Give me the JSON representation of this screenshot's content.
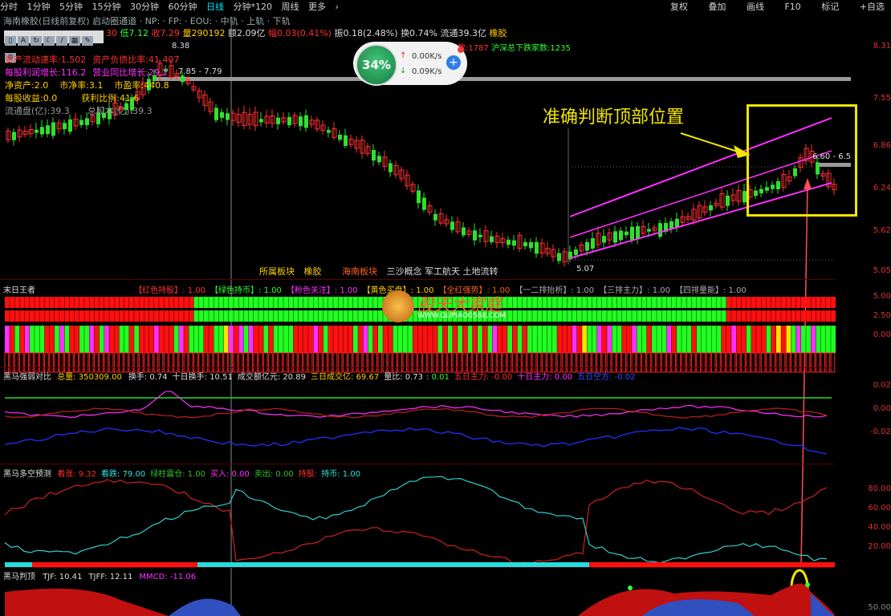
{
  "toolbar": {
    "periods": [
      "分时",
      "1分钟",
      "5分钟",
      "15分钟",
      "30分钟",
      "60分钟",
      "日线",
      "分钟*120",
      "周线",
      "更多"
    ],
    "active_period": "日线",
    "more_arrow": "›",
    "right_items": [
      "复权",
      "叠加",
      "画线",
      "F10",
      "标记",
      "+自选"
    ]
  },
  "title_line": {
    "name": "海南橡胶(日线前复权)",
    "rest": "启动圈通道 · NP: · FP: · EOU: · 中轨 · 上轨 · 下轨"
  },
  "quote_line": {
    "a": "30",
    "low": "低7.12",
    "close": "收7.29",
    "volume": "量290192",
    "amount": "额2.09亿",
    "change": "幅0.03(0.41%)",
    "amplitude": "振0.18(2.48%)",
    "turnover": "换0.74%",
    "float": "流通39.3亿",
    "concept": "橡胶"
  },
  "market_line": {
    "up": "沪深总上涨家数:1787",
    "down": "沪深总下跌家数:1235"
  },
  "finance": [
    {
      "label": "资产流动速率:1.502",
      "color": "#ff3030"
    },
    {
      "label": "资产负债比率:41.407",
      "color": "#ff3030"
    },
    {
      "label": "每股利润增长:116.2",
      "color": "#ff30ff"
    },
    {
      "label": "营业同比增长:29.2",
      "color": "#ff30ff"
    },
    {
      "label": "净资产:2.0",
      "color": "#ffd000"
    },
    {
      "label": "市净率:3.1",
      "color": "#ffd000"
    },
    {
      "label": "市盈率:440.8",
      "color": "#ffd000"
    },
    {
      "label": "每股收益:0.0",
      "color": "#ffd000"
    },
    {
      "label": "获利比例:41.6",
      "color": "#ffd000"
    },
    {
      "label": "流通盘(亿):39.3",
      "color": "#999999"
    },
    {
      "label": "总股本(亿):39.3",
      "color": "#999999"
    }
  ],
  "price_labels": {
    "high": "8.38",
    "range": "7.85 - 7.79",
    "low": "5.07",
    "right": "6.60 - 6.5"
  },
  "price_axis": [
    "8.31",
    "7.55",
    "6.86",
    "6.24",
    "5.62",
    "5.05"
  ],
  "speed": {
    "percent": "34%",
    "up": "0.00K/s",
    "down": "0.09K/s",
    "plus": "+"
  },
  "annotation": "准确判断顶部位置",
  "blocks": {
    "label1": "所属板块",
    "val1": "橡胶",
    "label2": "海南板块",
    "val2": "三沙概念 军工航天 土地流转"
  },
  "panel1": {
    "title": "末日王者",
    "items": [
      {
        "text": "【红色持股】: 1.00",
        "color": "#ff3030"
      },
      {
        "text": "【绿色持币】: 1.00",
        "color": "#30ff30"
      },
      {
        "text": "【粉色关注】: 1.00",
        "color": "#ff30ff"
      },
      {
        "text": "【黄色买盘】: 1.00",
        "color": "#ffd000"
      },
      {
        "text": "【全红强势】: 1.00",
        "color": "#ff6020"
      },
      {
        "text": "【一二排抬析】: 1.00",
        "color": "#aaaaaa"
      },
      {
        "text": "【三排主力】: 1.00",
        "color": "#aaaaaa"
      },
      {
        "text": "【四排量能】: 1.00",
        "color": "#aaaaaa"
      }
    ],
    "axis": [
      "5.00",
      "2.50",
      "0.00"
    ]
  },
  "watermark": {
    "title": "股天大家庭",
    "url": "WWW.GUPIAO0568.COM"
  },
  "panel2": {
    "title": "黑马强弱对比",
    "items": [
      {
        "text": "总量: 350309.00",
        "color": "#ffd000"
      },
      {
        "text": "换手: 0.74",
        "color": "#dddddd"
      },
      {
        "text": "十日换手: 10.51",
        "color": "#dddddd"
      },
      {
        "text": "成交额亿元: 20.89",
        "color": "#dddddd"
      },
      {
        "text": "三日成交亿: 69.67",
        "color": "#ffd000"
      },
      {
        "text": "量比: 0.73",
        "color": "#dddddd"
      },
      {
        "text": ": 0.01",
        "color": "#30ff30"
      },
      {
        "text": "五日主力: -0.00",
        "color": "#ff3030"
      },
      {
        "text": "十日主力: 0.00",
        "color": "#ff30ff"
      },
      {
        "text": "五日空方: -0.02",
        "color": "#3030ff"
      }
    ],
    "axis": [
      "0.02",
      "0.00",
      "-0.02"
    ]
  },
  "panel3": {
    "title": "黑马多空预测",
    "items": [
      {
        "text": "看涨: 9.32",
        "color": "#ff3030"
      },
      {
        "text": "看跌: 79.00",
        "color": "#30e0e0"
      },
      {
        "text": "绿柱震仓: 1.00",
        "color": "#30c030"
      },
      {
        "text": "买入: 0.00",
        "color": "#ff30ff"
      },
      {
        "text": "卖出: 0.00",
        "color": "#30c030"
      },
      {
        "text": "持股: ",
        "color": "#ff3030"
      },
      {
        "text": "持币: 1.00",
        "color": "#30e0e0"
      }
    ],
    "axis": [
      "80.00",
      "60.00",
      "40.00",
      "20.00"
    ]
  },
  "panel4": {
    "title": "黑马判顶",
    "items": [
      {
        "text": "TJF: 10.41",
        "color": "#dddddd"
      },
      {
        "text": "TJFF: 12.11",
        "color": "#dddddd"
      },
      {
        "text": "MMCD: -11.06",
        "color": "#ff30ff"
      }
    ],
    "axis": [
      "50.00"
    ]
  }
}
